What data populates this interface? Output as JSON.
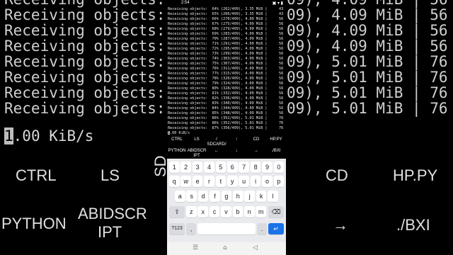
{
  "status_bar": {
    "time": "2:54",
    "right_icons": "▣ ▾ ▮"
  },
  "terminal": {
    "lines": [
      {
        "text": "Receiving objects:  64% (262/409), 3.35 MiB |",
        "tail": "43"
      },
      {
        "text": "Receiving objects:  65% (266/409), 3.35 MiB |",
        "tail": "43"
      },
      {
        "text": "Receiving objects:  66% (270/409), 4.09 MiB |",
        "tail": "56"
      },
      {
        "text": "Receiving objects:  67% (275/409), 4.09 MiB |",
        "tail": "56"
      },
      {
        "text": "Receiving objects:  68% (279/409), 4.09 MiB |",
        "tail": "56"
      },
      {
        "text": "Receiving objects:  69% (283/409), 4.09 MiB |",
        "tail": "56"
      },
      {
        "text": "Receiving objects:  70% (287/409), 4.09 MiB |",
        "tail": "56"
      },
      {
        "text": "Receiving objects:  71% (291/409), 4.09 MiB |",
        "tail": "56"
      },
      {
        "text": "Receiving objects:  72% (295/409), 4.09 MiB |",
        "tail": "56"
      },
      {
        "text": "Receiving objects:  73% (299/409), 4.09 MiB |",
        "tail": "56"
      },
      {
        "text": "Receiving objects:  74% (303/409), 4.09 MiB |",
        "tail": "56"
      },
      {
        "text": "Receiving objects:  75% (307/409), 4.09 MiB |",
        "tail": "56"
      },
      {
        "text": "Receiving objects:  76% (311/409), 4.09 MiB |",
        "tail": "56"
      },
      {
        "text": "Receiving objects:  77% (315/409), 4.09 MiB |",
        "tail": "56"
      },
      {
        "text": "Receiving objects:  78% (320/409), 4.09 MiB |",
        "tail": "56"
      },
      {
        "text": "Receiving objects:  79% (324/409), 4.09 MiB |",
        "tail": "56"
      },
      {
        "text": "Receiving objects:  80% (328/409), 4.09 MiB |",
        "tail": "56"
      },
      {
        "text": "Receiving objects:  81% (332/409), 4.09 MiB |",
        "tail": "56"
      },
      {
        "text": "Receiving objects:  82% (336/409), 4.09 MiB |",
        "tail": "56"
      },
      {
        "text": "Receiving objects:  83% (340/409), 4.09 MiB |",
        "tail": "56"
      },
      {
        "text": "Receiving objects:  84% (344/409), 4.09 MiB |",
        "tail": "56"
      },
      {
        "text": "Receiving objects:  85% (348/409), 4.09 MiB |",
        "tail": "56"
      },
      {
        "text": "Receiving objects:  86% (352/409), 5.01 MiB |",
        "tail": "76"
      },
      {
        "text": "Receiving objects:  86% (352/409), 5.01 MiB |",
        "tail": "76"
      },
      {
        "text": "Receiving objects:  87% (356/409), 5.01 MiB |",
        "tail": "76"
      }
    ],
    "speed_line": ".00 KiB/s",
    "cursor_char": "1"
  },
  "extra_keys": {
    "row1": [
      "CTRL",
      "LS",
      "/ SDCARD/",
      "↑",
      "CD",
      "HP.PY"
    ],
    "row2": [
      "PYTHON",
      "ABIDSCR IPT",
      "←",
      "↓",
      "→",
      "./BXI"
    ]
  },
  "keyboard": {
    "row_numbers": [
      "1",
      "2",
      "3",
      "4",
      "5",
      "6",
      "7",
      "8",
      "9",
      "0"
    ],
    "row_q": [
      "q",
      "w",
      "e",
      "r",
      "t",
      "y",
      "u",
      "i",
      "o",
      "p"
    ],
    "row_a": [
      "a",
      "s",
      "d",
      "f",
      "g",
      "h",
      "j",
      "k",
      "l"
    ],
    "row_z": [
      "z",
      "x",
      "c",
      "v",
      "b",
      "n",
      "m"
    ],
    "shift": "⇧",
    "backspace": "⌫",
    "symbols": "?123",
    "comma": ",",
    "period": ".",
    "enter": "↵"
  },
  "nav_bar": {
    "menu": "☰",
    "home": "⌂",
    "back": "◁"
  },
  "background": {
    "lines": [
      {
        "left": "Receiving objects:",
        "right": "09), 4.09 MiB | 56"
      },
      {
        "left": "Receiving objects:",
        "right": "09), 4.09 MiB | 56"
      },
      {
        "left": "Receiving objects:",
        "right": "09), 4.09 MiB | 56"
      },
      {
        "left": "Receiving objects:",
        "right": "09), 4.09 MiB | 56"
      },
      {
        "left": "Receiving objects:",
        "right": "09), 5.01 MiB | 76"
      },
      {
        "left": "Receiving objects:",
        "right": "09), 5.01 MiB | 76"
      },
      {
        "left": "Receiving objects:",
        "right": "09), 5.01 MiB | 76"
      },
      {
        "left": "Receiving objects:",
        "right": "09), 5.01 MiB | 76"
      }
    ],
    "speed_cursor": "1",
    "speed": ".00 KiB/s",
    "keys": [
      "CTRL",
      "LS",
      "SD",
      "CD",
      "HP.PY",
      "PYTHON",
      "ABIDSCR",
      "IPT",
      "→",
      "./BXI"
    ]
  }
}
